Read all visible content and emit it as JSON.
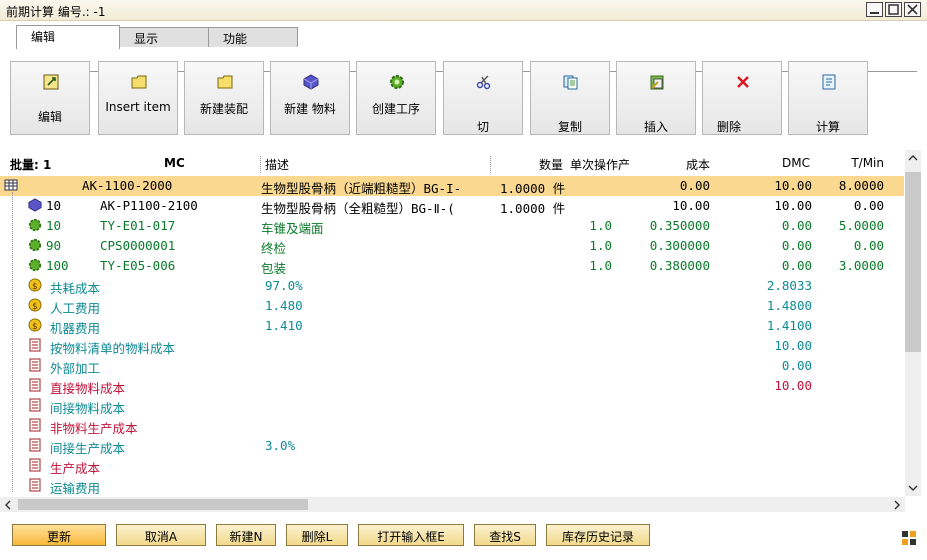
{
  "window": {
    "title": "前期计算 编号.: -1"
  },
  "tabs": [
    "编辑",
    "显示",
    "功能"
  ],
  "toolbar": [
    {
      "label": "编辑",
      "icon": "edit-icon"
    },
    {
      "label": "Insert item",
      "icon": "folder-icon"
    },
    {
      "label": "新建装配",
      "icon": "folder-icon"
    },
    {
      "label": "新建 物料",
      "icon": "material-cube-icon"
    },
    {
      "label": "创建工序",
      "icon": "gear-icon"
    },
    {
      "label": "切",
      "icon": "scissors-icon"
    },
    {
      "label": "复制",
      "icon": "copy-icon"
    },
    {
      "label": "插入",
      "icon": "paste-icon"
    },
    {
      "label": "删除",
      "icon": "delete-x-icon"
    },
    {
      "label": "计算",
      "icon": "calc-icon"
    }
  ],
  "grid": {
    "headers": {
      "qty": "批量: 1",
      "mc": "MC",
      "desc": "描述",
      "amount": "数量",
      "unit_op": "单次操作产",
      "cost": "成本",
      "dmc": "DMC",
      "tmin": "T/Min"
    },
    "rows": [
      {
        "icon": "table-icon",
        "mc": "AK-1100-2000",
        "desc": "生物型股骨柄（近端粗糙型）BG-I-",
        "amount": "1.0000 件",
        "unit_op": "",
        "cost": "0.00",
        "dmc": "10.00",
        "tmin": "8.0000",
        "color": "black",
        "selected": true
      },
      {
        "icon": "material-cube-icon",
        "num": "10",
        "mc": "AK-P1100-2100",
        "desc": "生物型股骨柄（全粗糙型）BG-Ⅱ-(",
        "amount": "1.0000 件",
        "unit_op": "",
        "cost": "10.00",
        "dmc": "10.00",
        "tmin": "0.00",
        "color": "black"
      },
      {
        "icon": "gear-icon",
        "num": "10",
        "mc": "TY-E01-017",
        "desc": "车锥及端面",
        "amount": "",
        "unit_op": "1.0",
        "cost": "0.350000",
        "dmc": "0.00",
        "tmin": "5.0000",
        "color": "green"
      },
      {
        "icon": "gear-icon",
        "num": "90",
        "mc": "CPS0000001",
        "desc": "终检",
        "amount": "",
        "unit_op": "1.0",
        "cost": "0.300000",
        "dmc": "0.00",
        "tmin": "0.00",
        "color": "green"
      },
      {
        "icon": "gear-icon",
        "num": "100",
        "mc": "TY-E05-006",
        "desc": "包装",
        "amount": "",
        "unit_op": "1.0",
        "cost": "0.380000",
        "dmc": "0.00",
        "tmin": "3.0000",
        "color": "green"
      },
      {
        "icon": "coin-icon",
        "label": "共耗成本",
        "desc": "97.0%",
        "dmc": "2.8033",
        "color": "teal"
      },
      {
        "icon": "coin-icon",
        "label": "人工费用",
        "desc": "1.480",
        "dmc": "1.4800",
        "color": "teal"
      },
      {
        "icon": "coin-icon",
        "label": "机器费用",
        "desc": "1.410",
        "dmc": "1.4100",
        "color": "teal"
      },
      {
        "icon": "doc-icon",
        "label": "按物料清单的物料成本",
        "desc": "",
        "dmc": "10.00",
        "color": "teal"
      },
      {
        "icon": "doc-icon",
        "label": "外部加工",
        "desc": "",
        "dmc": "0.00",
        "color": "teal"
      },
      {
        "icon": "doc-icon",
        "label": "直接物料成本",
        "desc": "",
        "dmc": "10.00",
        "color": "red"
      },
      {
        "icon": "doc-icon",
        "label": "间接物料成本",
        "desc": "",
        "dmc": "",
        "color": "teal"
      },
      {
        "icon": "doc-icon",
        "label": "非物料生产成本",
        "desc": "",
        "dmc": "",
        "color": "red"
      },
      {
        "icon": "doc-icon",
        "label": "间接生产成本",
        "desc": "3.0%",
        "dmc": "",
        "color": "teal"
      },
      {
        "icon": "doc-icon",
        "label": "生产成本",
        "desc": "",
        "dmc": "",
        "color": "red"
      },
      {
        "icon": "doc-icon",
        "label": "运输费用",
        "desc": "",
        "dmc": "",
        "color": "teal"
      }
    ]
  },
  "footer_buttons": [
    "更新",
    "取消A",
    "新建N",
    "删除L",
    "打开输入框E",
    "查找S",
    "库存历史记录"
  ],
  "colors": {
    "selected_row": "#fad890",
    "green": "#0a7a2a",
    "teal": "#0d8a94",
    "red": "#c0143a"
  }
}
